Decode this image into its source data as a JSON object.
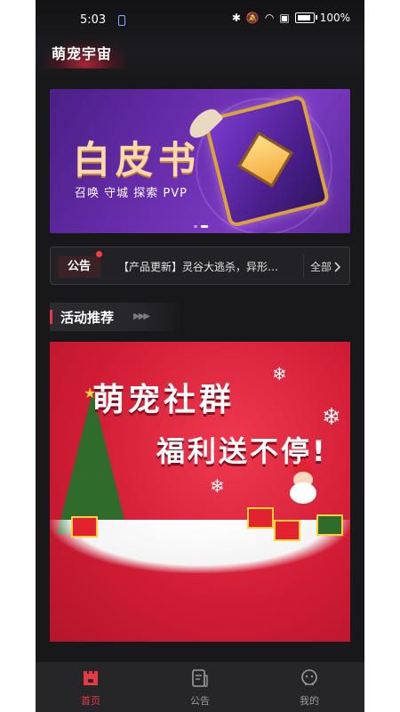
{
  "statusbar": {
    "time": "5:03",
    "battery": "100%"
  },
  "brand": {
    "name": "萌宠宇宙"
  },
  "banner": {
    "title": "白皮书",
    "subtitle": "召唤 守城 探索 PVP"
  },
  "notice": {
    "tag": "公告",
    "text": "【产品更新】灵谷大逃杀，异形…",
    "all": "全部"
  },
  "section": {
    "title": "活动推荐"
  },
  "promo": {
    "line1": "萌宠社群",
    "line2": "福利送不停!"
  },
  "tabs": [
    {
      "label": "首页",
      "icon": "home-icon",
      "active": true
    },
    {
      "label": "公告",
      "icon": "notice-icon",
      "active": false
    },
    {
      "label": "我的",
      "icon": "profile-icon",
      "active": false
    }
  ],
  "colors": {
    "accent": "#e53946",
    "background": "#18181b"
  }
}
